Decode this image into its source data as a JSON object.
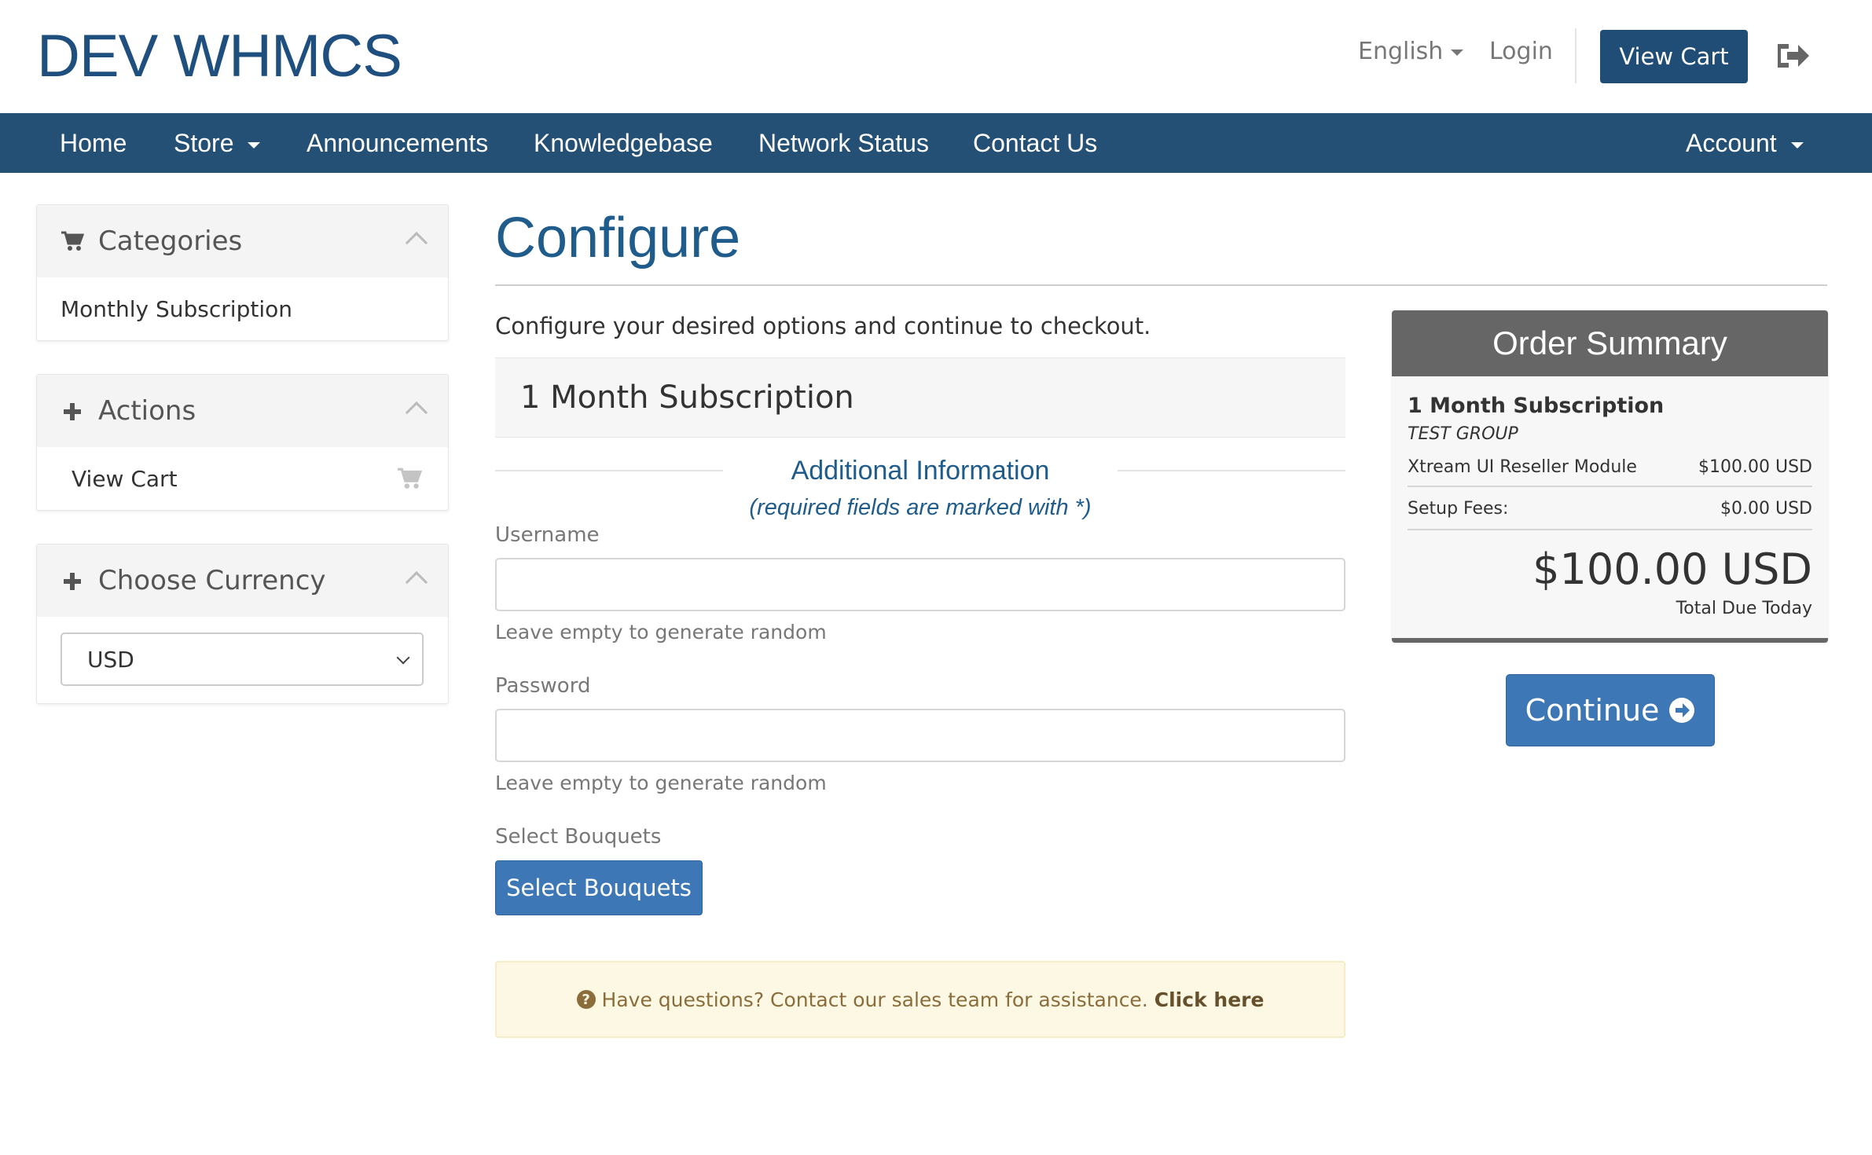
{
  "header": {
    "logo": "DEV WHMCS",
    "language": "English",
    "login": "Login",
    "view_cart": "View Cart"
  },
  "nav": {
    "items": [
      "Home",
      "Store",
      "Announcements",
      "Knowledgebase",
      "Network Status",
      "Contact Us"
    ],
    "account": "Account"
  },
  "sidebar": {
    "categories": {
      "title": "Categories",
      "items": [
        "Monthly Subscription"
      ]
    },
    "actions": {
      "title": "Actions",
      "items": [
        "View Cart"
      ]
    },
    "currency": {
      "title": "Choose Currency",
      "selected": "USD"
    }
  },
  "main": {
    "title": "Configure",
    "intro": "Configure your desired options and continue to checkout.",
    "product": "1 Month Subscription",
    "additional_title": "Additional Information",
    "additional_sub": "(required fields are marked with *)",
    "username_label": "Username",
    "username_value": "",
    "username_help": "Leave empty to generate random",
    "password_label": "Password",
    "password_value": "",
    "password_help": "Leave empty to generate random",
    "bouquets_label": "Select Bouquets",
    "bouquets_button": "Select Bouquets",
    "alert_text": "Have questions? Contact our sales team for assistance.",
    "alert_link": "Click here"
  },
  "summary": {
    "title": "Order Summary",
    "product": "1 Month Subscription",
    "group": "TEST GROUP",
    "line_item": "Xtream UI Reseller Module",
    "line_price": "$100.00 USD",
    "setup_label": "Setup Fees:",
    "setup_price": "$0.00 USD",
    "total": "$100.00 USD",
    "total_label": "Total Due Today",
    "continue": "Continue"
  },
  "colors": {
    "brand": "#1f4d75",
    "nav_bg": "#245075",
    "button": "#3d77b5",
    "summary_head": "#666666",
    "alert_bg": "#fcf8e3"
  }
}
